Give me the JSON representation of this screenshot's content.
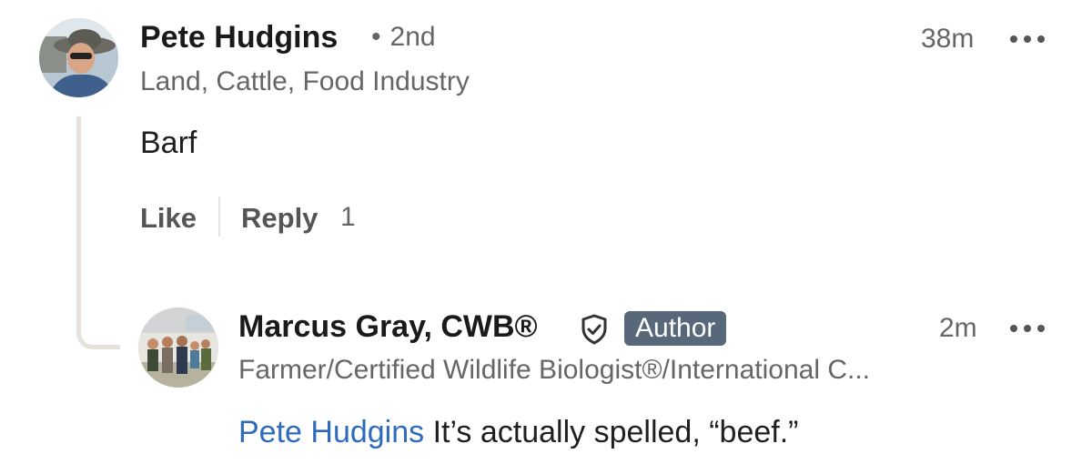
{
  "comment": {
    "author_name": "Pete Hudgins",
    "degree_separator": "•",
    "degree": "2nd",
    "headline": "Land, Cattle, Food Industry",
    "time": "38m",
    "text": "Barf",
    "like_label": "Like",
    "reply_label": "Reply",
    "reply_count": "1",
    "more_icon": "more-horizontal-icon"
  },
  "reply": {
    "author_name": "Marcus Gray, CWB®",
    "verified_icon": "verified-shield-icon",
    "badge": "Author",
    "headline": "Farmer/Certified Wildlife Biologist®/International C...",
    "time": "2m",
    "mention": "Pete Hudgins",
    "text": " It’s actually spelled, “beef.”",
    "more_icon": "more-horizontal-icon"
  },
  "colors": {
    "mention": "#2f6bbd",
    "badge_bg": "#56687a",
    "thread_line": "#e6e2dc",
    "secondary_text": "#666666"
  }
}
